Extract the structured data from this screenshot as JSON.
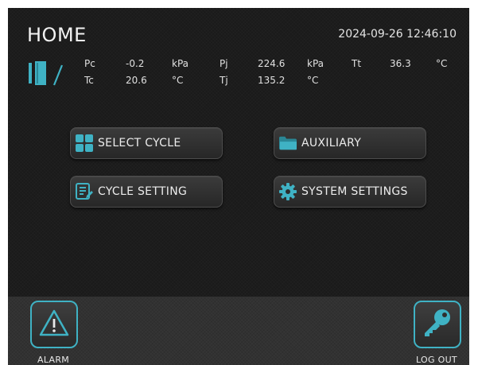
{
  "header": {
    "title": "HOME",
    "datetime": "2024-09-26 12:46:10"
  },
  "readings": {
    "pc": {
      "label": "Pc",
      "value": "-0.2",
      "unit": "kPa"
    },
    "pj": {
      "label": "Pj",
      "value": "224.6",
      "unit": "kPa"
    },
    "tt": {
      "label": "Tt",
      "value": "36.3",
      "unit": "°C"
    },
    "tc": {
      "label": "Tc",
      "value": "20.6",
      "unit": "°C"
    },
    "tj": {
      "label": "Tj",
      "value": "135.2",
      "unit": "°C"
    }
  },
  "menu": {
    "select_cycle": "SELECT CYCLE",
    "auxiliary": "AUXILIARY",
    "cycle_setting": "CYCLE SETTING",
    "system_settings": "SYSTEM SETTINGS"
  },
  "footer": {
    "alarm": "ALARM",
    "logout": "LOG OUT"
  },
  "colors": {
    "accent": "#3fb2c4",
    "background": "#1a1a1a",
    "bottom_bar": "#353535"
  },
  "icons": {
    "status": "door-open-icon",
    "select_cycle": "grid-icon",
    "auxiliary": "folder-icon",
    "cycle_setting": "list-edit-icon",
    "system_settings": "gear-icon",
    "alarm": "warning-icon",
    "logout": "key-icon"
  }
}
